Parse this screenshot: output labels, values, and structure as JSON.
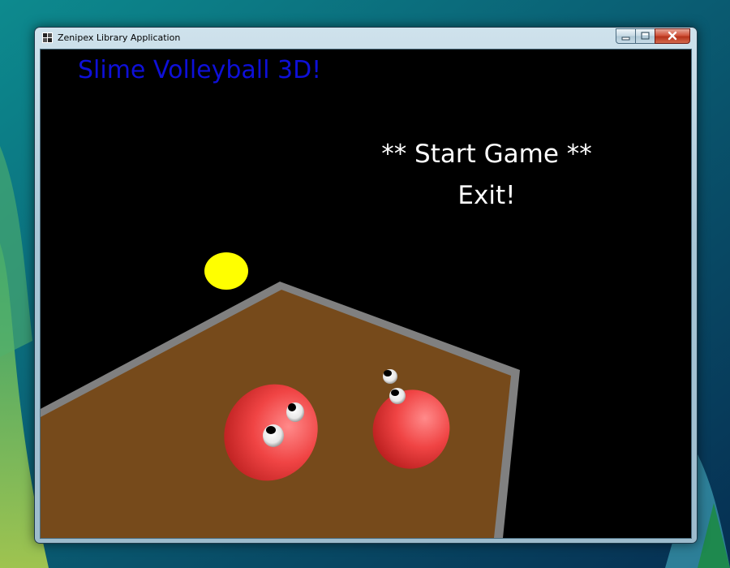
{
  "window": {
    "title": "Zenipex Library Application",
    "controls": {
      "minimize": "minimize-icon",
      "maximize": "maximize-icon",
      "close": "close-icon"
    }
  },
  "game": {
    "title": "Slime Volleyball 3D!",
    "title_color": "#0e10d8",
    "menu": [
      {
        "label": "** Start Game **",
        "selected": true
      },
      {
        "label": "Exit!",
        "selected": false
      }
    ]
  },
  "scene": {
    "court_color": "#764a1b",
    "border_color": "#808080",
    "ball_color": "#ffff00",
    "slime_color": "#f04444"
  }
}
